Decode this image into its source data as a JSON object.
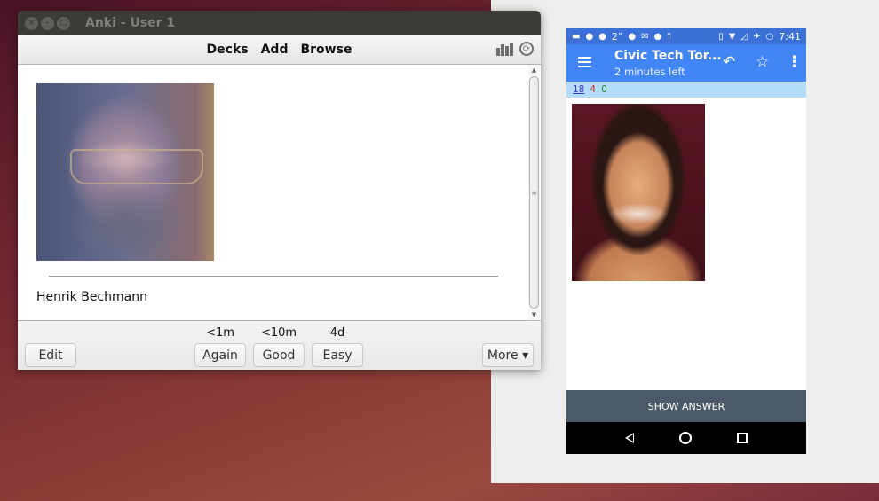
{
  "desktop": {
    "background_color": "#7a2e34",
    "panel_color": "#ededeb"
  },
  "anki": {
    "window_title": "Anki - User 1",
    "window_controls": [
      "close",
      "minimize",
      "maximize"
    ],
    "toolbar": {
      "links": [
        "Decks",
        "Add",
        "Browse"
      ],
      "icons": [
        "stats-icon",
        "sync-icon"
      ]
    },
    "card": {
      "front_image": "photo of bearded man with glasses",
      "answer": "Henrik Bechmann"
    },
    "bottom": {
      "edit_label": "Edit",
      "more_label": "More ▾",
      "answers": [
        {
          "interval": "<1m",
          "label": "Again"
        },
        {
          "interval": "<10m",
          "label": "Good"
        },
        {
          "interval": "4d",
          "label": "Easy"
        }
      ]
    }
  },
  "phone": {
    "status_bar": {
      "temperature": "2°",
      "time": "7:41",
      "accent_color": "#3b70d6"
    },
    "app_bar": {
      "title": "Civic Tech Tor...",
      "subtitle": "2 minutes left",
      "color": "#4285f4",
      "actions": [
        "undo-icon",
        "star-icon",
        "overflow-menu-icon"
      ]
    },
    "counts": {
      "new": "18",
      "learning": "4",
      "review": "0"
    },
    "card": {
      "front_image": "photo of smiling woman with beaded necklace"
    },
    "show_answer_label": "SHOW ANSWER",
    "nav": [
      "back",
      "home",
      "recents"
    ]
  }
}
